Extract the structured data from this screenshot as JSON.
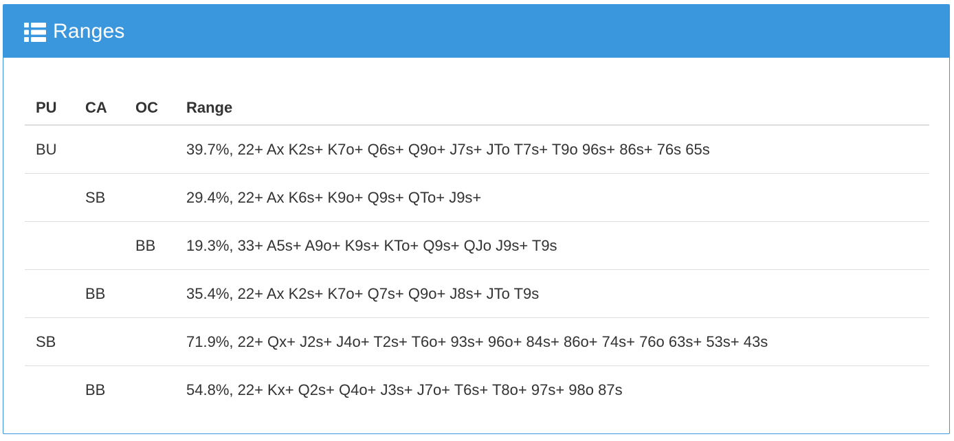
{
  "panel": {
    "title": "Ranges",
    "icon": "list-icon",
    "accent_color": "#3a96dd"
  },
  "table": {
    "headers": [
      "PU",
      "CA",
      "OC",
      "Range"
    ],
    "rows": [
      {
        "pu": "BU",
        "ca": "",
        "oc": "",
        "range": "39.7%, 22+ Ax K2s+ K7o+ Q6s+ Q9o+ J7s+ JTo T7s+ T9o 96s+ 86s+ 76s 65s"
      },
      {
        "pu": "",
        "ca": "SB",
        "oc": "",
        "range": "29.4%, 22+ Ax K6s+ K9o+ Q9s+ QTo+ J9s+"
      },
      {
        "pu": "",
        "ca": "",
        "oc": "BB",
        "range": "19.3%, 33+ A5s+ A9o+ K9s+ KTo+ Q9s+ QJo J9s+ T9s"
      },
      {
        "pu": "",
        "ca": "BB",
        "oc": "",
        "range": "35.4%, 22+ Ax K2s+ K7o+ Q7s+ Q9o+ J8s+ JTo T9s"
      },
      {
        "pu": "SB",
        "ca": "",
        "oc": "",
        "range": "71.9%, 22+ Qx+ J2s+ J4o+ T2s+ T6o+ 93s+ 96o+ 84s+ 86o+ 74s+ 76o 63s+ 53s+ 43s"
      },
      {
        "pu": "",
        "ca": "BB",
        "oc": "",
        "range": "54.8%, 22+ Kx+ Q2s+ Q4o+ J3s+ J7o+ T6s+ T8o+ 97s+ 98o 87s"
      }
    ]
  }
}
